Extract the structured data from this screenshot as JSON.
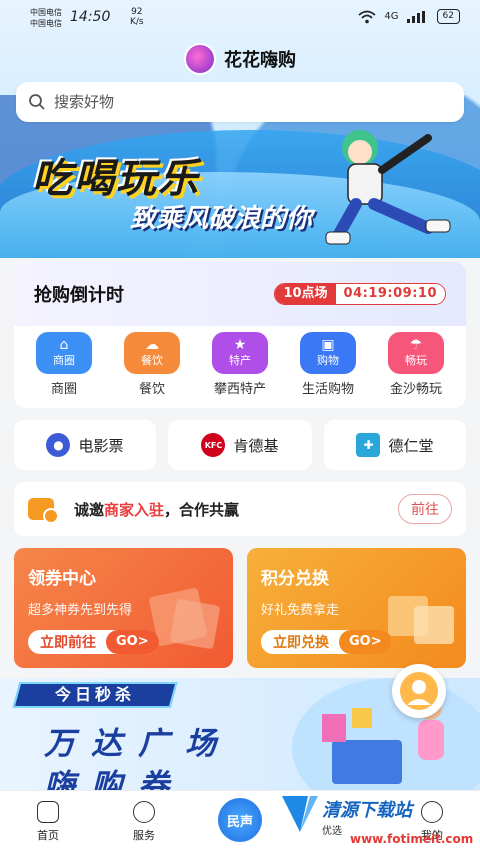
{
  "status_bar": {
    "carrier1": "中国电信",
    "carrier2": "中国电信",
    "time": "14:50",
    "net_speed_value": "92",
    "net_speed_unit": "K/s",
    "network_type": "4G",
    "battery": "62"
  },
  "app": {
    "name": "花花嗨购"
  },
  "search": {
    "placeholder": "搜索好物"
  },
  "banner": {
    "title": "吃喝玩乐",
    "subtitle": "致乘风破浪的你"
  },
  "countdown": {
    "title": "抢购倒计时",
    "session": "10点场",
    "time": "04:19:09:10"
  },
  "categories": [
    {
      "icon_text": "商圈",
      "label": "商圈",
      "color": "#3b8ff5"
    },
    {
      "icon_text": "餐饮",
      "label": "餐饮",
      "color": "#f58a3b"
    },
    {
      "icon_text": "特产",
      "label": "攀西特产",
      "color": "#b04ee8"
    },
    {
      "icon_text": "购物",
      "label": "生活购物",
      "color": "#3b78f5"
    },
    {
      "icon_text": "畅玩",
      "label": "金沙畅玩",
      "color": "#f5567a"
    }
  ],
  "quick_links": [
    {
      "label": "电影票",
      "icon": "film-reel-icon"
    },
    {
      "label": "肯德基",
      "icon": "kfc-logo-icon",
      "icon_text": "KFC"
    },
    {
      "label": "德仁堂",
      "icon": "medical-kit-icon"
    }
  ],
  "invite": {
    "prefix": "诚邀",
    "highlight": "商家入驻",
    "suffix": "，合作共赢",
    "button": "前往"
  },
  "promos": [
    {
      "title": "领券中心",
      "subtitle": "超多神券先到先得",
      "button": "立即前往",
      "go": "GO>",
      "accent": "#f26a3a"
    },
    {
      "title": "积分兑换",
      "subtitle": "好礼免费拿走",
      "button": "立即兑换",
      "go": "GO>",
      "accent": "#f39b2a"
    }
  ],
  "flash_sale": {
    "tag": "今日秒杀",
    "line1": "万达广场",
    "line2": "嗨购券"
  },
  "bottom_nav": {
    "home": "首页",
    "service": "服务",
    "center": "民声",
    "mine": "我的"
  },
  "watermark": {
    "title": "清源下载站",
    "subtitle": "优选",
    "url": "www.fotimeit.com"
  }
}
